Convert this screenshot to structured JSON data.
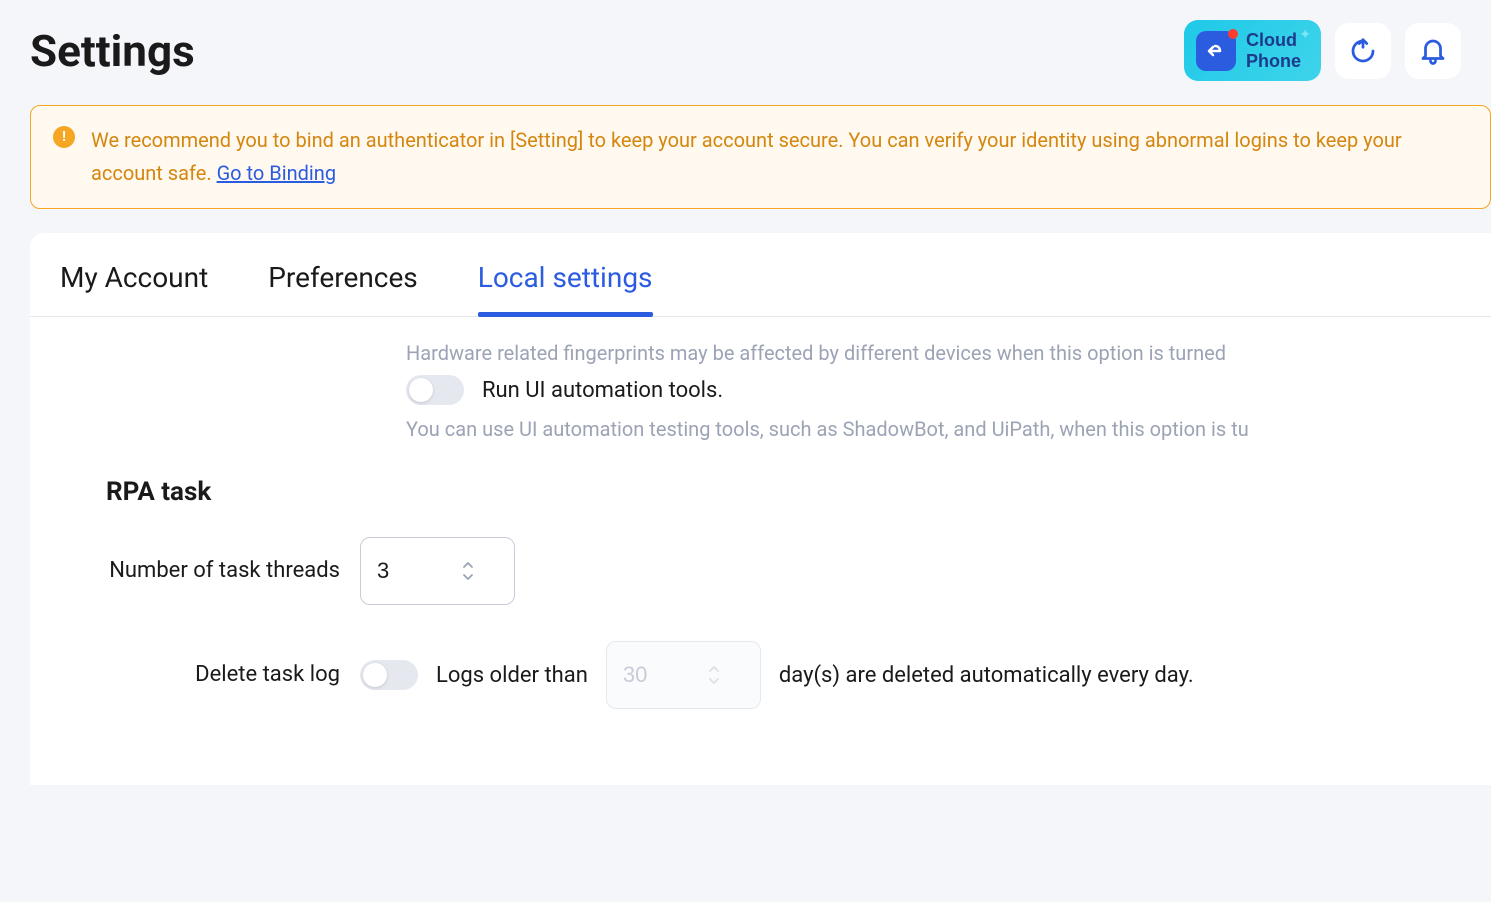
{
  "page": {
    "title": "Settings"
  },
  "header": {
    "cloud_phone_label": "Cloud\nPhone"
  },
  "alert": {
    "text_part1": "We recommend you to bind an authenticator in [Setting] to keep your account secure. You can verify your identity using abnormal logins to keep your account safe. ",
    "link_text": "Go to Binding"
  },
  "tabs": {
    "items": [
      {
        "label": "My Account"
      },
      {
        "label": "Preferences"
      },
      {
        "label": "Local settings"
      }
    ],
    "active_index": 2
  },
  "settings": {
    "partial_hardware_text": "Hardware related fingerprints may be affected by different devices when this option is turned",
    "ui_automation": {
      "label": "Run UI automation tools.",
      "description": "You can use UI automation testing tools, such as ShadowBot, and UiPath, when this option is tu",
      "enabled": false
    },
    "rpa": {
      "section_title": "RPA task",
      "threads": {
        "label": "Number of task threads",
        "value": "3"
      },
      "delete_log": {
        "label": "Delete task log",
        "enabled": false,
        "text_before": "Logs older than",
        "days_value": "30",
        "text_after": "day(s) are deleted automatically every day."
      }
    }
  }
}
